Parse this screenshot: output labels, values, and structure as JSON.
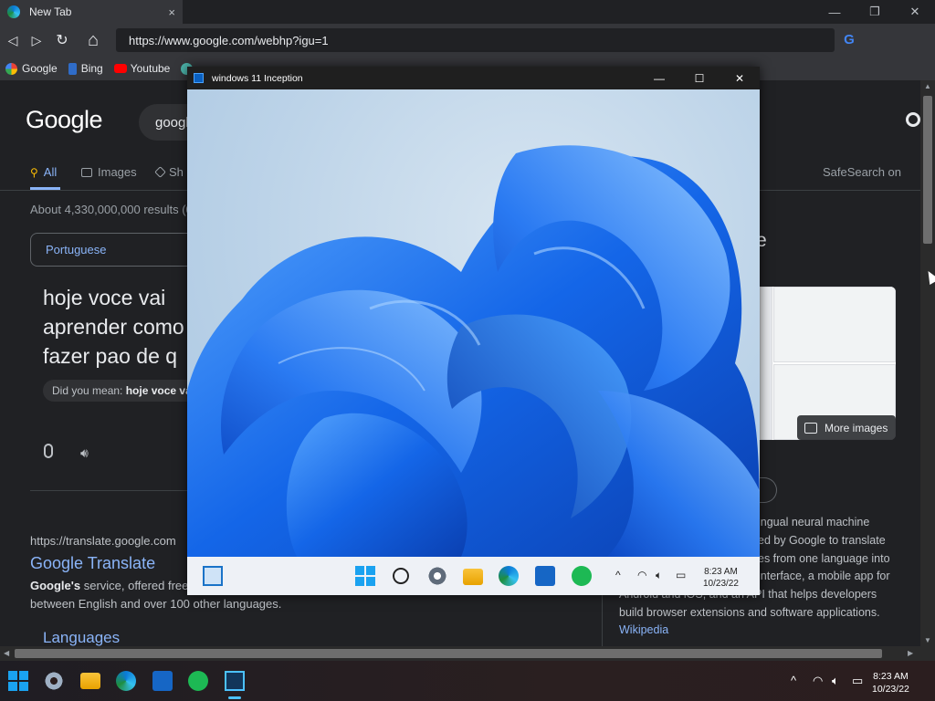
{
  "browser": {
    "tab_title": "New Tab",
    "tab_close": "×",
    "url": "https://www.google.com/webhp?igu=1",
    "search_badge": "G",
    "window_controls": {
      "minimize": "—",
      "restore": "❐",
      "close": "✕"
    },
    "nav": {
      "back": "◁",
      "forward": "▷",
      "refresh": "↻",
      "home": "⌂"
    },
    "bookmarks": [
      {
        "label": "Google",
        "color": "#ffffff"
      },
      {
        "label": "Bing",
        "color": "#2f6cc8"
      },
      {
        "label": "Youtube",
        "color": "#ff0000"
      }
    ]
  },
  "google": {
    "logo": "Google",
    "search_query": "googl",
    "tabs": {
      "all": "All",
      "images": "Images",
      "shopping": "Sh"
    },
    "safesearch": "SafeSearch on",
    "results_count": "About 4,330,000,000 results (0.",
    "translate": {
      "source_lang": "Portuguese",
      "source_text": "hoje voce vai aprender como fazer pao de q",
      "did_you_mean_label": "Did you mean:",
      "did_you_mean_value": "hoje voce va"
    },
    "result": {
      "url": "https://translate.google.com",
      "title": "Google Translate",
      "snippet_bold": "Google's",
      "snippet_rest": " service, offered free of charge, between English and over 100 other languages.",
      "snippet_line1_end": "service, offered free",
      "snippet_line2": "between English and over 100 other languages.",
      "sublink": "Languages"
    },
    "knowledge_panel": {
      "title_fragment": "e",
      "more_images": "More images",
      "chip_fragment": "n",
      "desc_lines": [
        "ingual neural machine",
        "ed by Google to translate",
        "es from one language into",
        "interface, a mobile app for",
        "Android and iOS, and an API that helps developers",
        "build browser extensions and software applications."
      ],
      "wiki_link": "Wikipedia"
    }
  },
  "vm": {
    "title": "windows 11 Inception",
    "controls": {
      "minimize": "—",
      "maximize": "☐",
      "close": "✕"
    },
    "clock_time": "8:23 AM",
    "clock_date": "10/23/22"
  },
  "host_taskbar": {
    "clock_time": "8:23 AM",
    "clock_date": "10/23/22"
  },
  "colors": {
    "accent_link": "#8ab4f8",
    "win_blue": "#1aa2f0",
    "spotify_green": "#1db954"
  }
}
